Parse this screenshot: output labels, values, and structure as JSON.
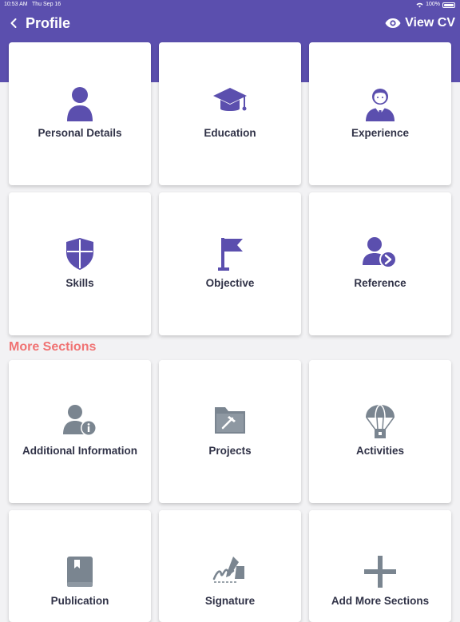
{
  "status_bar": {
    "time": "10:53 AM",
    "date": "Thu Sep 16",
    "battery": "100%"
  },
  "nav": {
    "title": "Profile",
    "view_cv_label": "View CV"
  },
  "colors": {
    "primary": "#5b4fae",
    "section_heading": "#f07373",
    "muted_icon": "#7a8590",
    "card_text": "#303247"
  },
  "profile_cards": [
    {
      "label": "Personal Details",
      "icon": "person-icon"
    },
    {
      "label": "Education",
      "icon": "graduation-cap-icon"
    },
    {
      "label": "Experience",
      "icon": "businessman-icon"
    },
    {
      "label": "Skills",
      "icon": "shield-icon"
    },
    {
      "label": "Objective",
      "icon": "flag-icon"
    },
    {
      "label": "Reference",
      "icon": "person-arrow-icon"
    }
  ],
  "more_sections": {
    "heading": "More Sections",
    "cards": [
      {
        "label": "Additional Information",
        "icon": "person-info-icon"
      },
      {
        "label": "Projects",
        "icon": "folder-hammer-icon"
      },
      {
        "label": "Activities",
        "icon": "parachute-icon"
      },
      {
        "label": "Publication",
        "icon": "book-icon"
      },
      {
        "label": "Signature",
        "icon": "signature-icon"
      },
      {
        "label": "Add More Sections",
        "icon": "plus-icon"
      }
    ]
  }
}
